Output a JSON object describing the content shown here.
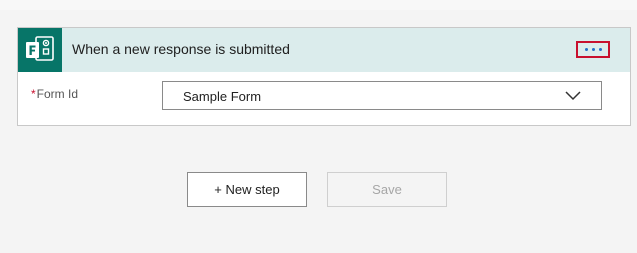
{
  "trigger_card": {
    "title": "When a new response is submitted",
    "app_icon": "microsoft-forms-icon",
    "more_options_icon": "ellipsis-icon",
    "header_color": "#dbecec",
    "icon_tile_color": "#077568",
    "highlight_color": "#c8102e"
  },
  "form_field": {
    "required_marker": "*",
    "label": "Form Id",
    "selected_value": "Sample Form",
    "dropdown_icon": "chevron-down-icon"
  },
  "actions": {
    "new_step_label": "+ New step",
    "save_label": "Save"
  }
}
